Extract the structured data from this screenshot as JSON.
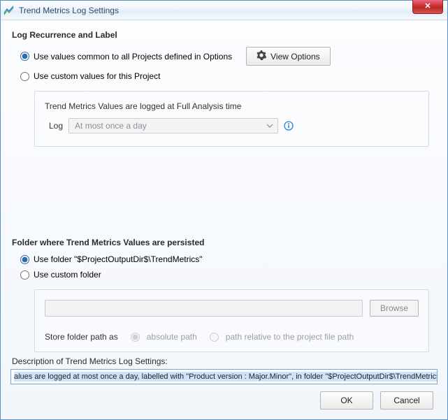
{
  "window": {
    "title": "Trend Metrics Log Settings"
  },
  "recurrence": {
    "heading": "Log Recurrence and Label",
    "common_label": "Use values common to all Projects defined in Options",
    "custom_label": "Use custom values for this Project",
    "view_options_btn": "View Options",
    "groupbox_title": "Trend Metrics Values are logged at Full Analysis time",
    "log_label": "Log",
    "log_value": "At most once a day"
  },
  "folder": {
    "heading": "Folder where Trend Metrics Values are persisted",
    "use_folder_label": "Use folder  \"$ProjectOutputDir$\\TrendMetrics\"",
    "use_custom_label": "Use custom folder",
    "browse_btn": "Browse",
    "store_label": "Store folder path as",
    "absolute_label": "absolute path",
    "relative_label": "path relative to the project file path",
    "path_value": ""
  },
  "description": {
    "label": "Description of Trend Metrics Log Settings:",
    "value": "alues are logged at most once a day, labelled with \"Product version : Major.Minor\", in folder \"$ProjectOutputDir$\\TrendMetrics\"."
  },
  "buttons": {
    "ok": "OK",
    "cancel": "Cancel"
  }
}
